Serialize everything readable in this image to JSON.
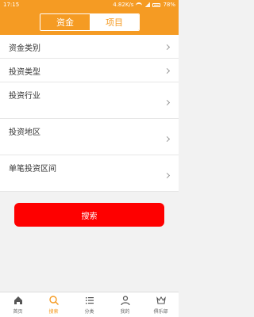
{
  "status_bar": {
    "time": "17:15",
    "network_speed": "4.82K/s",
    "battery": "78%"
  },
  "segment": {
    "tabs": [
      {
        "label": "资金",
        "active": true
      },
      {
        "label": "项目",
        "active": false
      }
    ]
  },
  "filters": [
    {
      "label": "资金类别"
    },
    {
      "label": "投资类型"
    },
    {
      "label": "投资行业"
    },
    {
      "label": "投资地区"
    },
    {
      "label": "单笔投资区间"
    }
  ],
  "search_button": {
    "label": "搜索"
  },
  "tabbar": {
    "items": [
      {
        "label": "首页",
        "icon": "home-icon",
        "active": false
      },
      {
        "label": "搜索",
        "icon": "search-icon",
        "active": true
      },
      {
        "label": "分类",
        "icon": "list-icon",
        "active": false
      },
      {
        "label": "我的",
        "icon": "person-icon",
        "active": false
      },
      {
        "label": "俱乐部",
        "icon": "crown-icon",
        "active": false
      }
    ]
  },
  "colors": {
    "accent": "#f59b23",
    "search_button": "#fe0000"
  }
}
